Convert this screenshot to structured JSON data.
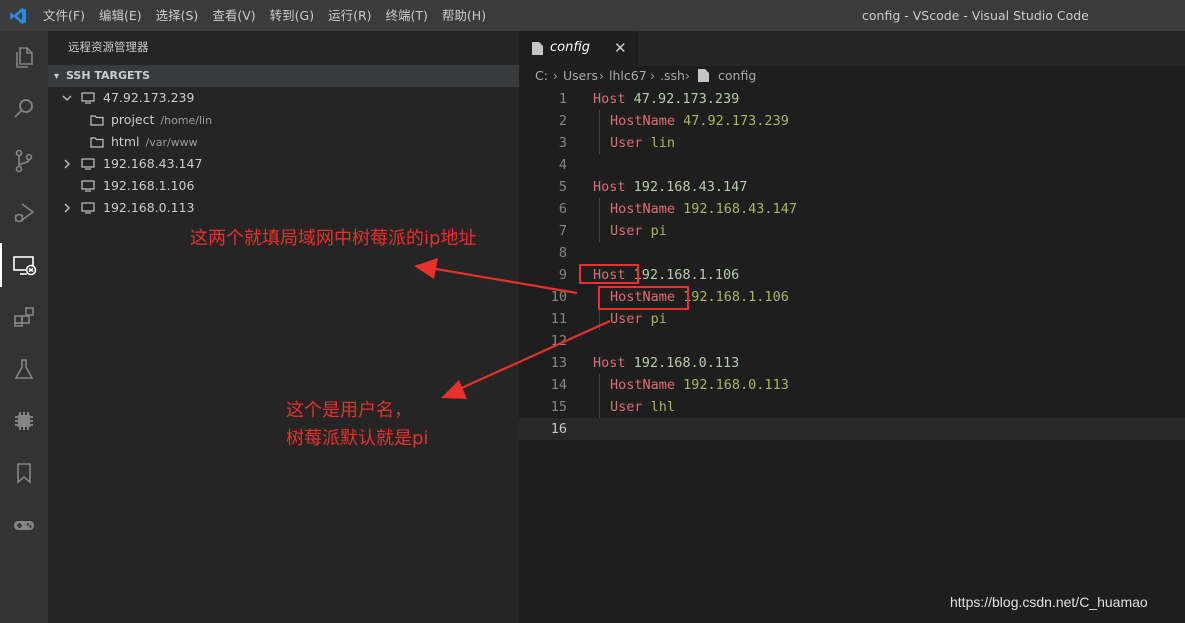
{
  "window": {
    "title": "config - VScode - Visual Studio Code",
    "menu": [
      "文件(F)",
      "编辑(E)",
      "选择(S)",
      "查看(V)",
      "转到(G)",
      "运行(R)",
      "终端(T)",
      "帮助(H)"
    ]
  },
  "activity_bar": {
    "items": [
      "explorer",
      "search",
      "source-control",
      "run-debug",
      "remote-explorer",
      "extensions",
      "testing",
      "hardware",
      "bookmarks",
      "gamepad"
    ],
    "active": "remote-explorer"
  },
  "sidebar": {
    "title": "远程资源管理器",
    "section": "SSH TARGETS",
    "targets": [
      {
        "label": "47.92.173.239",
        "expanded": true,
        "children": [
          {
            "label": "project",
            "path": "/home/lin"
          },
          {
            "label": "html",
            "path": "/var/www"
          }
        ]
      },
      {
        "label": "192.168.43.147",
        "expanded": false
      },
      {
        "label": "192.168.1.106",
        "expanded": false
      },
      {
        "label": "192.168.0.113",
        "expanded": false
      }
    ]
  },
  "editor": {
    "tab": {
      "label": "config",
      "close": "✕"
    },
    "breadcrumb": [
      "C:",
      "Users",
      "lhlc67",
      ".ssh",
      "config"
    ],
    "lines": [
      {
        "n": "1",
        "key": "Host",
        "val": " 47.92.173.239"
      },
      {
        "n": "2",
        "key": "HostName",
        "val": " 47.92.173.239"
      },
      {
        "n": "3",
        "key": "User",
        "val": " lin"
      },
      {
        "n": "4",
        "key": "",
        "val": ""
      },
      {
        "n": "5",
        "key": "Host",
        "val": " 192.168.43.147"
      },
      {
        "n": "6",
        "key": "HostName",
        "val": " 192.168.43.147"
      },
      {
        "n": "7",
        "key": "User",
        "val": " pi"
      },
      {
        "n": "8",
        "key": "",
        "val": ""
      },
      {
        "n": "9",
        "key": "Host",
        "val": " 192.168.1.106"
      },
      {
        "n": "10",
        "key": "HostName",
        "val": " 192.168.1.106"
      },
      {
        "n": "11",
        "key": "User",
        "val": " pi"
      },
      {
        "n": "12",
        "key": "",
        "val": ""
      },
      {
        "n": "13",
        "key": "Host",
        "val": " 192.168.0.113"
      },
      {
        "n": "14",
        "key": "HostName",
        "val": " 192.168.0.113"
      },
      {
        "n": "15",
        "key": "User",
        "val": " lhl"
      },
      {
        "n": "16",
        "key": "",
        "val": ""
      }
    ]
  },
  "annotations": {
    "note1": "这两个就填局域网中树莓派的ip地址",
    "note2_line1": "这个是用户名，",
    "note2_line2": "树莓派默认就是pi",
    "color": "#e8302c"
  },
  "watermark": "https://blog.csdn.net/C_huamao"
}
